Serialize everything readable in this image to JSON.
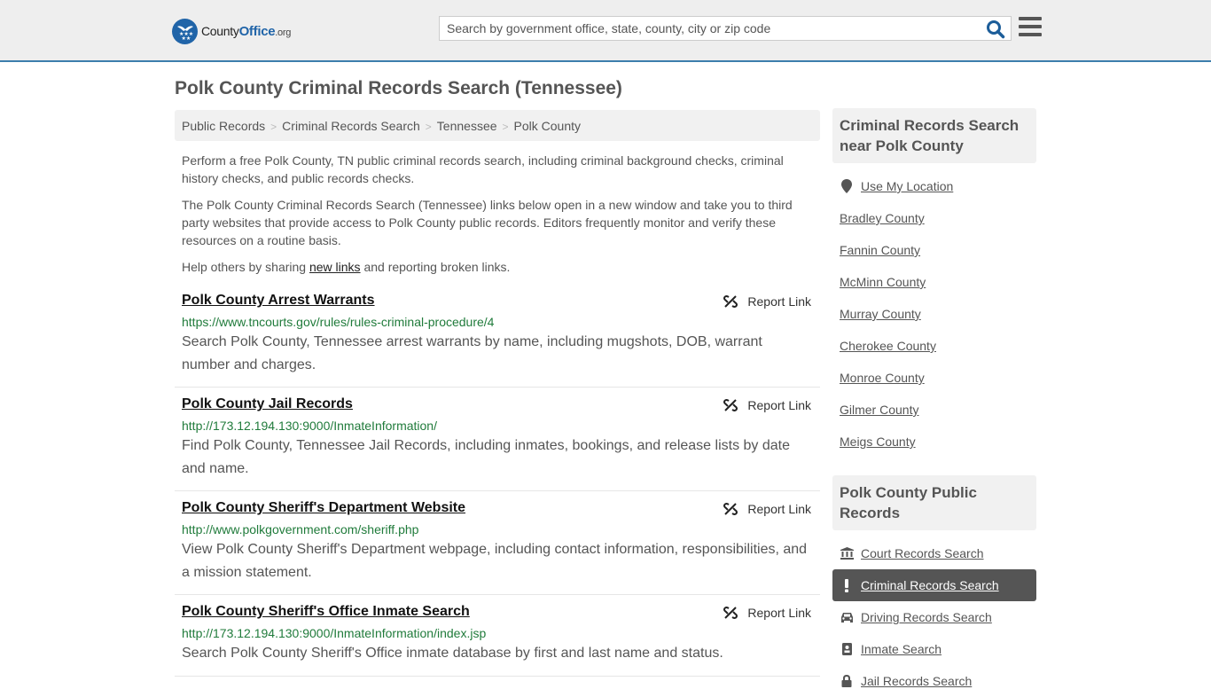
{
  "header": {
    "logo": {
      "county": "County",
      "office": "Office",
      "tld": ".org"
    },
    "search_placeholder": "Search by government office, state, county, city or zip code",
    "search_value": ""
  },
  "page_title": "Polk County Criminal Records Search (Tennessee)",
  "breadcrumb": [
    "Public Records",
    "Criminal Records Search",
    "Tennessee",
    "Polk County"
  ],
  "intro": {
    "p1": "Perform a free Polk County, TN public criminal records search, including criminal background checks, criminal history checks, and public records checks.",
    "p2": "The Polk County Criminal Records Search (Tennessee) links below open in a new window and take you to third party websites that provide access to Polk County public records. Editors frequently monitor and verify these resources on a routine basis.",
    "p3_before": "Help others by sharing ",
    "p3_link": "new links",
    "p3_after": " and reporting broken links."
  },
  "report_label": "Report Link",
  "results": [
    {
      "title": "Polk County Arrest Warrants",
      "url": "https://www.tncourts.gov/rules/rules-criminal-procedure/4",
      "description": "Search Polk County, Tennessee arrest warrants by name, including mugshots, DOB, warrant number and charges."
    },
    {
      "title": "Polk County Jail Records",
      "url": "http://173.12.194.130:9000/InmateInformation/",
      "description": "Find Polk County, Tennessee Jail Records, including inmates, bookings, and release lists by date and name."
    },
    {
      "title": "Polk County Sheriff's Department Website",
      "url": "http://www.polkgovernment.com/sheriff.php",
      "description": "View Polk County Sheriff's Department webpage, including contact information, responsibilities, and a mission statement."
    },
    {
      "title": "Polk County Sheriff's Office Inmate Search",
      "url": "http://173.12.194.130:9000/InmateInformation/index.jsp",
      "description": "Search Polk County Sheriff's Office inmate database by first and last name and status."
    }
  ],
  "sidebar": {
    "nearby": {
      "heading": "Criminal Records Search near Polk County",
      "use_location": "Use My Location",
      "counties": [
        "Bradley County",
        "Fannin County",
        "McMinn County",
        "Murray County",
        "Cherokee County",
        "Monroe County",
        "Gilmer County",
        "Meigs County"
      ]
    },
    "public_records": {
      "heading": "Polk County Public Records",
      "items": [
        {
          "label": "Court Records Search",
          "icon": "courthouse-icon",
          "active": false
        },
        {
          "label": "Criminal Records Search",
          "icon": "exclamation-icon",
          "active": true
        },
        {
          "label": "Driving Records Search",
          "icon": "car-icon",
          "active": false
        },
        {
          "label": "Inmate Search",
          "icon": "id-badge-icon",
          "active": false
        },
        {
          "label": "Jail Records Search",
          "icon": "lock-icon",
          "active": false
        }
      ]
    }
  }
}
